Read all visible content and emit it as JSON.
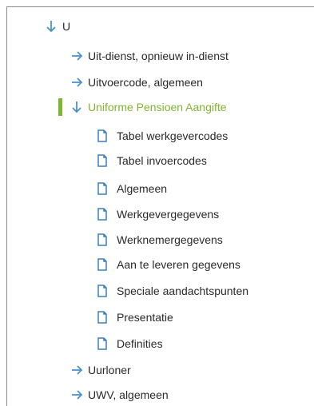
{
  "colors": {
    "arrow": "#4a8fcf",
    "active": "#82b433",
    "active_bar": "#7cb82f",
    "doc_icon": "#3f7ec0"
  },
  "tree": {
    "root": {
      "label": "U",
      "icon": "arrow-down-icon"
    },
    "items": [
      {
        "label": "Uit-dienst, opnieuw in-dienst",
        "icon": "arrow-right-icon"
      },
      {
        "label": "Uitvoercode, algemeen",
        "icon": "arrow-right-icon"
      },
      {
        "label": "Uniforme Pensioen Aangifte",
        "icon": "arrow-down-icon",
        "selected": true,
        "children": [
          {
            "label": "Tabel werkgevercodes",
            "icon": "document-icon"
          },
          {
            "label": "Tabel invoercodes",
            "icon": "document-icon"
          },
          {
            "label": "Algemeen",
            "icon": "document-icon"
          },
          {
            "label": "Werkgevergegevens",
            "icon": "document-icon"
          },
          {
            "label": "Werknemergegevens",
            "icon": "document-icon"
          },
          {
            "label": "Aan te leveren gegevens",
            "icon": "document-icon"
          },
          {
            "label": "Speciale aandachtspunten",
            "icon": "document-icon"
          },
          {
            "label": "Presentatie",
            "icon": "document-icon"
          },
          {
            "label": "Definities",
            "icon": "document-icon"
          }
        ]
      },
      {
        "label": "Uurloner",
        "icon": "arrow-right-icon"
      },
      {
        "label": "UWV, algemeen",
        "icon": "arrow-right-icon"
      }
    ]
  }
}
